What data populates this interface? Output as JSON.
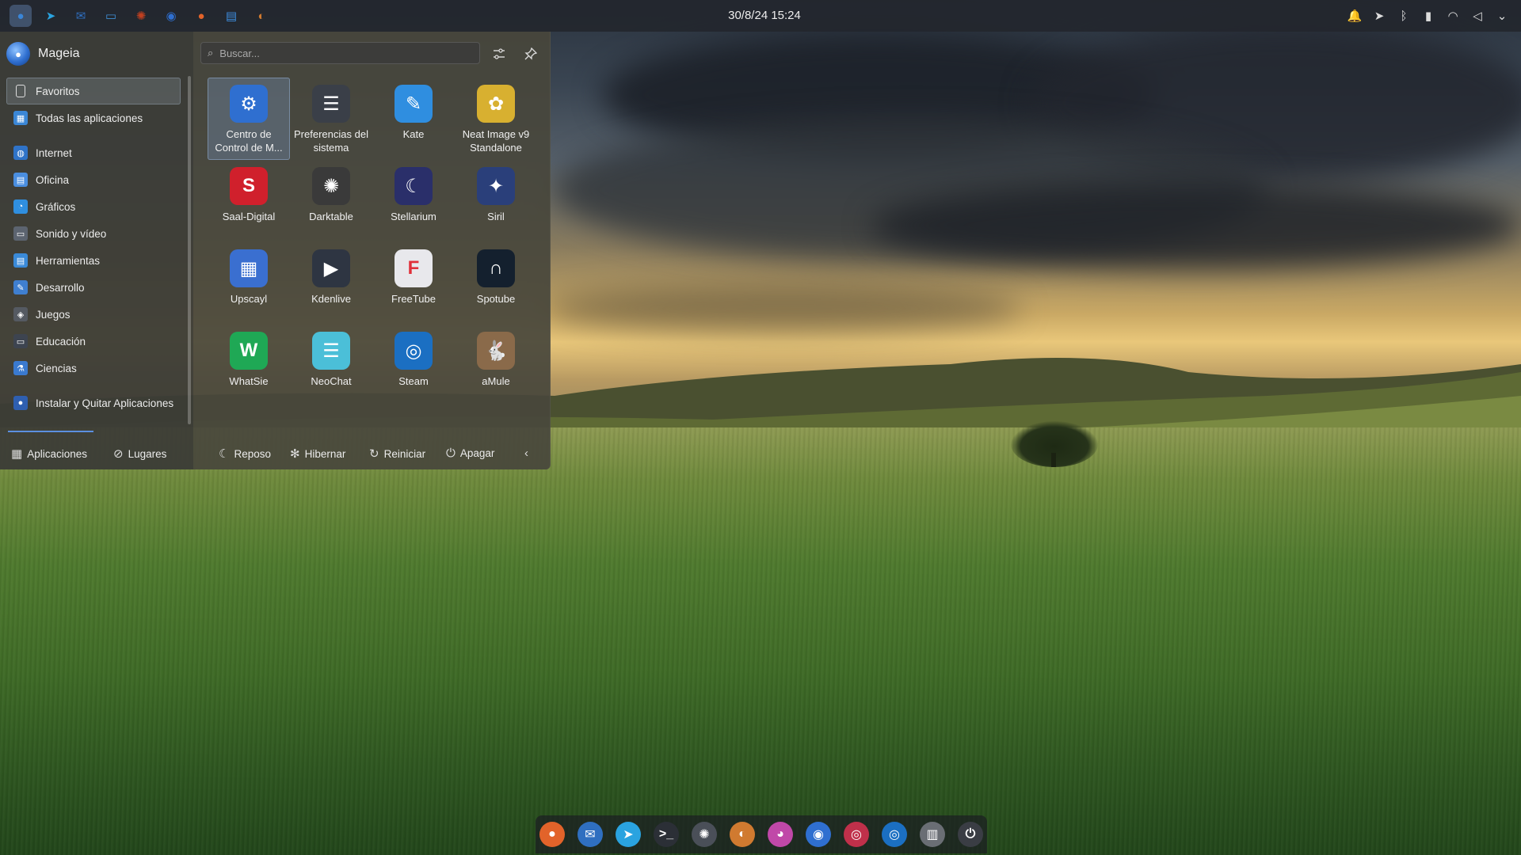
{
  "top_panel": {
    "clock": "30/8/24 15:24",
    "tasks": [
      {
        "name": "mageia-launcher-icon",
        "glyph": "●",
        "color": "#3a86d8"
      },
      {
        "name": "telegram-icon",
        "glyph": "➤",
        "color": "#2aa3e0"
      },
      {
        "name": "thunderbird-icon",
        "glyph": "✉",
        "color": "#2f6fc0"
      },
      {
        "name": "dolphin-file-manager-icon",
        "glyph": "▭",
        "color": "#3f8fd6"
      },
      {
        "name": "darktable-icon",
        "glyph": "✺",
        "color": "#c04020"
      },
      {
        "name": "mageia-control-icon",
        "glyph": "◉",
        "color": "#2f6fd0"
      },
      {
        "name": "firefox-icon",
        "glyph": "●",
        "color": "#e2632a"
      },
      {
        "name": "document-viewer-icon",
        "glyph": "▤",
        "color": "#3d8ee0"
      },
      {
        "name": "amule-icon",
        "glyph": "◐",
        "color": "#d07a30"
      }
    ],
    "tray": [
      {
        "name": "notifications-icon",
        "glyph": "🔔"
      },
      {
        "name": "telegram-tray-icon",
        "glyph": "➤"
      },
      {
        "name": "bluetooth-icon",
        "glyph": "ᛒ"
      },
      {
        "name": "battery-icon",
        "glyph": "▮"
      },
      {
        "name": "wifi-icon",
        "glyph": "◠"
      },
      {
        "name": "volume-icon",
        "glyph": "◁"
      },
      {
        "name": "chevron-down-icon",
        "glyph": "⌄"
      }
    ]
  },
  "launcher": {
    "user": "Mageia",
    "search": {
      "placeholder": "Buscar..."
    },
    "categories": [
      {
        "label": "Favoritos",
        "icon": "bookmark-icon",
        "glyph": "▯",
        "color": "transparent",
        "selected": true
      },
      {
        "label": "Todas las aplicaciones",
        "icon": "all-apps-icon",
        "glyph": "▦",
        "color": "#3b87d6",
        "selected": false
      },
      {
        "label": "Internet",
        "icon": "internet-icon",
        "glyph": "◍",
        "color": "#2f73c8",
        "selected": false
      },
      {
        "label": "Oficina",
        "icon": "office-icon",
        "glyph": "▤",
        "color": "#4a8ee0",
        "selected": false
      },
      {
        "label": "Gráficos",
        "icon": "graphics-icon",
        "glyph": "◔",
        "color": "#2f8fe0",
        "selected": false
      },
      {
        "label": "Sonido y vídeo",
        "icon": "multimedia-icon",
        "glyph": "▭",
        "color": "#5c6470",
        "selected": false
      },
      {
        "label": "Herramientas",
        "icon": "utilities-icon",
        "glyph": "▤",
        "color": "#3a8ad8",
        "selected": false
      },
      {
        "label": "Desarrollo",
        "icon": "development-icon",
        "glyph": "✎",
        "color": "#3f7fd0",
        "selected": false
      },
      {
        "label": "Juegos",
        "icon": "games-icon",
        "glyph": "◈",
        "color": "#555a62",
        "selected": false
      },
      {
        "label": "Educación",
        "icon": "education-icon",
        "glyph": "▭",
        "color": "#3d4450",
        "selected": false
      },
      {
        "label": "Ciencias",
        "icon": "science-icon",
        "glyph": "⚗",
        "color": "#3a7ad0",
        "selected": false
      },
      {
        "label": "Instalar y Quitar Aplicaciones",
        "icon": "install-remove-icon",
        "glyph": "●",
        "color": "#2f5fb0",
        "selected": false
      }
    ],
    "apps": [
      {
        "label": "Centro de Control de M...",
        "icon": "mageia-control-center-icon",
        "glyph": "⚙",
        "color": "#2f6fd0",
        "selected": true
      },
      {
        "label": "Preferencias del sistema",
        "icon": "system-settings-icon",
        "glyph": "☰",
        "color": "#3a3f48",
        "selected": false
      },
      {
        "label": "Kate",
        "icon": "kate-icon",
        "glyph": "✎",
        "color": "#2f8ee0",
        "selected": false
      },
      {
        "label": "Neat Image v9 Standalone",
        "icon": "neat-image-icon",
        "glyph": "✿",
        "color": "#d8b030",
        "selected": false
      },
      {
        "label": "Saal-Digital",
        "icon": "saal-digital-icon",
        "glyph": "S",
        "color": "#d0202c",
        "selected": false
      },
      {
        "label": "Darktable",
        "icon": "darktable-icon",
        "glyph": "✺",
        "color": "#3a3a3a",
        "selected": false
      },
      {
        "label": "Stellarium",
        "icon": "stellarium-icon",
        "glyph": "☾",
        "color": "#2a2f6a",
        "selected": false
      },
      {
        "label": "Siril",
        "icon": "siril-icon",
        "glyph": "✦",
        "color": "#2a3f7a",
        "selected": false
      },
      {
        "label": "Upscayl",
        "icon": "upscayl-icon",
        "glyph": "▦",
        "color": "#3a6fd0",
        "selected": false
      },
      {
        "label": "Kdenlive",
        "icon": "kdenlive-icon",
        "glyph": "▶",
        "color": "#2e3542",
        "selected": false
      },
      {
        "label": "FreeTube",
        "icon": "freetube-icon",
        "glyph": "F",
        "color": "#e8e8ec",
        "selected": false
      },
      {
        "label": "Spotube",
        "icon": "spotube-icon",
        "glyph": "∩",
        "color": "#14202e",
        "selected": false
      },
      {
        "label": "WhatSie",
        "icon": "whatsie-icon",
        "glyph": "W",
        "color": "#1fa855",
        "selected": false
      },
      {
        "label": "NeoChat",
        "icon": "neochat-icon",
        "glyph": "☰",
        "color": "#4bbfd8",
        "selected": false
      },
      {
        "label": "Steam",
        "icon": "steam-icon",
        "glyph": "◎",
        "color": "#1b6fc2",
        "selected": false
      },
      {
        "label": "aMule",
        "icon": "amule-icon",
        "glyph": "🐇",
        "color": "#8a6a4a",
        "selected": false
      }
    ],
    "footer": {
      "applications": "Aplicaciones",
      "places": "Lugares",
      "sleep": "Reposo",
      "hibernate": "Hibernar",
      "restart": "Reiniciar",
      "shutdown": "Apagar"
    }
  },
  "dock": [
    {
      "name": "firefox-dock-icon",
      "glyph": "●",
      "color": "#e2632a"
    },
    {
      "name": "thunderbird-dock-icon",
      "glyph": "✉",
      "color": "#2f6fc0"
    },
    {
      "name": "telegram-dock-icon",
      "glyph": "➤",
      "color": "#2aa3e0"
    },
    {
      "name": "terminal-dock-icon",
      "glyph": ">_",
      "color": "#2b2f36"
    },
    {
      "name": "aperture-dock-icon",
      "glyph": "✺",
      "color": "#4a4f58"
    },
    {
      "name": "amule-dock-icon",
      "glyph": "◐",
      "color": "#d07a30"
    },
    {
      "name": "color-picker-dock-icon",
      "glyph": "◕",
      "color": "#c048a8"
    },
    {
      "name": "mageia-control-dock-icon",
      "glyph": "◉",
      "color": "#2f6fd0"
    },
    {
      "name": "record-dock-icon",
      "glyph": "◎",
      "color": "#c0304a"
    },
    {
      "name": "steam-dock-icon",
      "glyph": "◎",
      "color": "#1b6fc2"
    },
    {
      "name": "clipboard-dock-icon",
      "glyph": "▥",
      "color": "#6a6e74"
    },
    {
      "name": "power-dock-icon",
      "glyph": "⏻",
      "color": "#3a3d44"
    }
  ]
}
